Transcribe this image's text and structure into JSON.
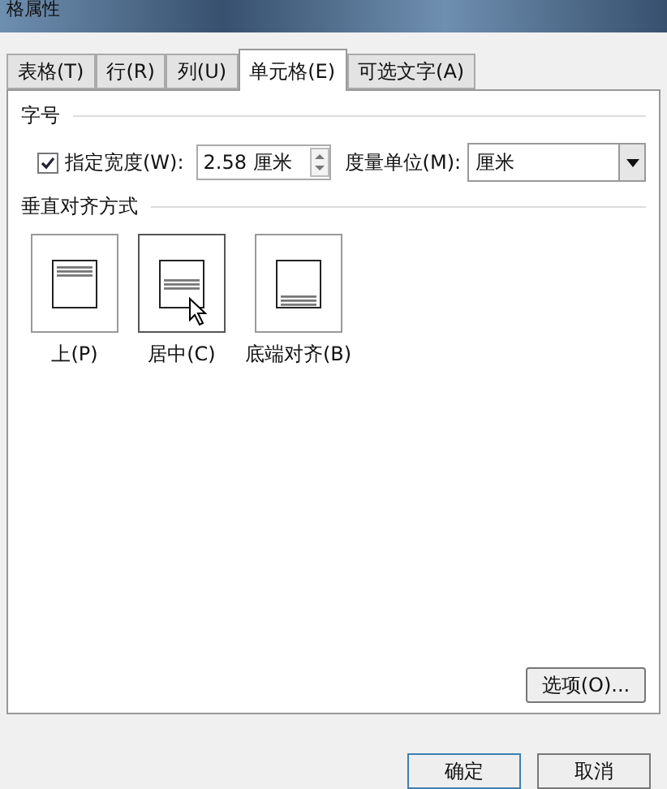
{
  "window": {
    "title": "格属性"
  },
  "tabs": [
    {
      "label": "表格(T)",
      "selected": false
    },
    {
      "label": "行(R)",
      "selected": false
    },
    {
      "label": "列(U)",
      "selected": false
    },
    {
      "label": "单元格(E)",
      "selected": true
    },
    {
      "label": "可选文字(A)",
      "selected": false
    }
  ],
  "size_section": {
    "title": "字号",
    "width_checkbox": {
      "label": "指定宽度(W):",
      "checked": true
    },
    "width_value": "2.58 厘米",
    "unit_label": "度量单位(M):",
    "unit_value": "厘米"
  },
  "alignment_section": {
    "title": "垂直对齐方式",
    "options": [
      {
        "kind": "top",
        "label": "上(P)",
        "selected": false
      },
      {
        "kind": "center",
        "label": "居中(C)",
        "selected": true
      },
      {
        "kind": "bottom",
        "label": "底端对齐(B)",
        "selected": false
      }
    ]
  },
  "options_button": "选项(O)...",
  "buttons": [
    "确定",
    "取消"
  ]
}
